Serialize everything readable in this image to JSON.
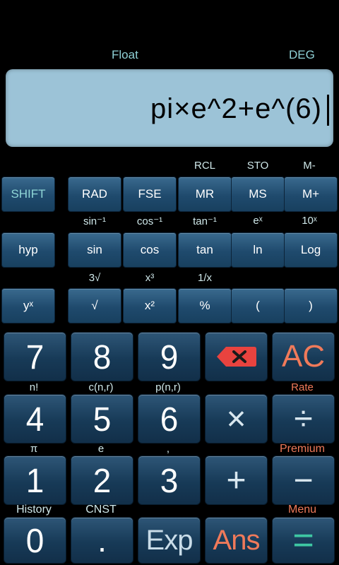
{
  "status": {
    "mode": "Float",
    "angle_unit": "DEG"
  },
  "display": {
    "expression": "pi×e^2+e^(6)"
  },
  "rows": {
    "row1_labels": [
      "RCL",
      "STO",
      "M-"
    ],
    "row1_keys": [
      "SHIFT",
      "RAD",
      "FSE",
      "MR",
      "MS",
      "M+"
    ],
    "row2_labels": [
      "sin⁻¹",
      "cos⁻¹",
      "tan⁻¹",
      "eˣ",
      "10ˣ"
    ],
    "row2_keys": [
      "hyp",
      "sin",
      "cos",
      "tan",
      "ln",
      "Log"
    ],
    "row3_labels": [
      "3√",
      "x³",
      "1/x"
    ],
    "row3_keys": [
      "yˣ",
      "√",
      "x²",
      "%",
      "(",
      ")"
    ],
    "row4_keys": [
      "7",
      "8",
      "9",
      "AC"
    ],
    "row5_labels": [
      "n!",
      "c(n,r)",
      "p(n,r)",
      "Rate"
    ],
    "row5_keys": [
      "4",
      "5",
      "6",
      "×",
      "÷"
    ],
    "row6_labels": [
      "π",
      "e",
      ",",
      "Premium"
    ],
    "row6_keys": [
      "1",
      "2",
      "3",
      "+",
      "−"
    ],
    "row7_labels": [
      "History",
      "CNST",
      "Menu"
    ],
    "row7_keys": [
      "0",
      ".",
      "Exp",
      "Ans",
      "="
    ]
  },
  "icons": {
    "delete": "backspace-icon"
  },
  "colors": {
    "accent_orange": "#f07a5a",
    "accent_teal": "#3ec7a3",
    "display_bg": "#9cc3d7"
  }
}
